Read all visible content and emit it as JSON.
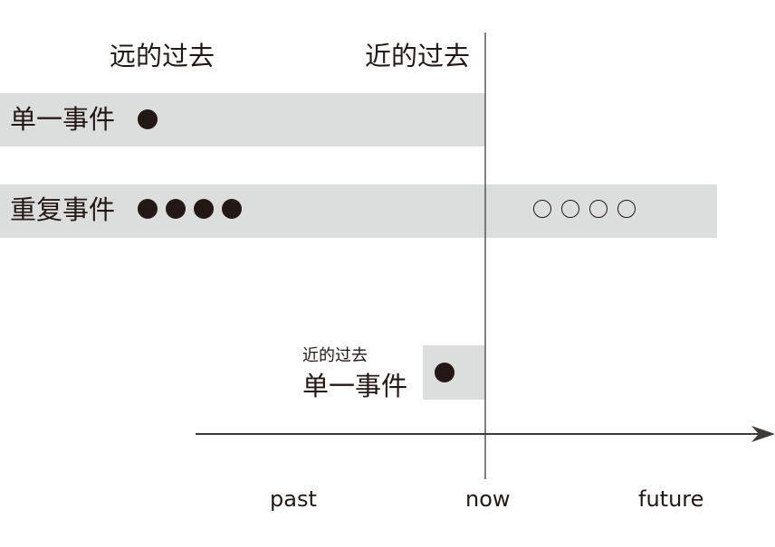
{
  "headers": {
    "far_past": "远的过去",
    "near_past": "近的过去"
  },
  "rows": {
    "single_event": "单一事件",
    "repeated_event": "重复事件"
  },
  "near_past_box": {
    "caption": "近的过去",
    "label": "单一事件"
  },
  "axis": {
    "past": "past",
    "now": "now",
    "future": "future"
  },
  "markers": {
    "single_event_filled": 1,
    "repeated_event_filled": 4,
    "repeated_event_hollow": 4,
    "near_past_filled": 1
  },
  "colors": {
    "band": "#dcdddd",
    "ink": "#231815",
    "now_line": "#595757",
    "axis": "#3e3a39"
  }
}
